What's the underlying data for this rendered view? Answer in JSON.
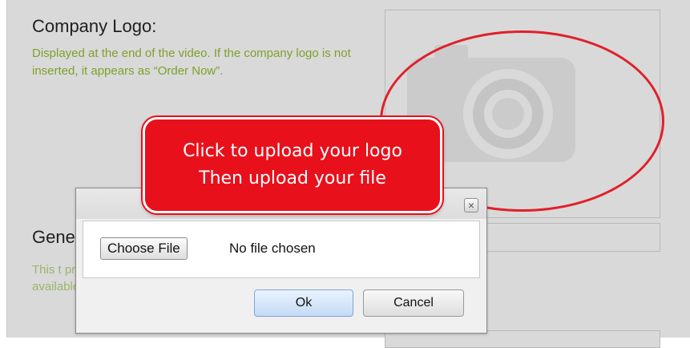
{
  "logo_section": {
    "title": "Company Logo:",
    "description": "Displayed at the end of the video. If the company logo is not inserted, it appears as “Order Now”."
  },
  "general_section": {
    "title": "Gene",
    "description": "This t product's short description, if no product description is available."
  },
  "callout": {
    "line1": "Click to upload your logo",
    "line2": "Then upload your file"
  },
  "dialog": {
    "close_label": "×",
    "choose_file_label": "Choose File",
    "file_status": "No file chosen",
    "ok_label": "Ok",
    "cancel_label": "Cancel"
  },
  "icons": {
    "camera": "camera-icon",
    "close": "close-icon"
  },
  "colors": {
    "callout_red": "#e8101b",
    "description_green": "#7fa02c",
    "panel_gray": "#d9d9d9"
  }
}
